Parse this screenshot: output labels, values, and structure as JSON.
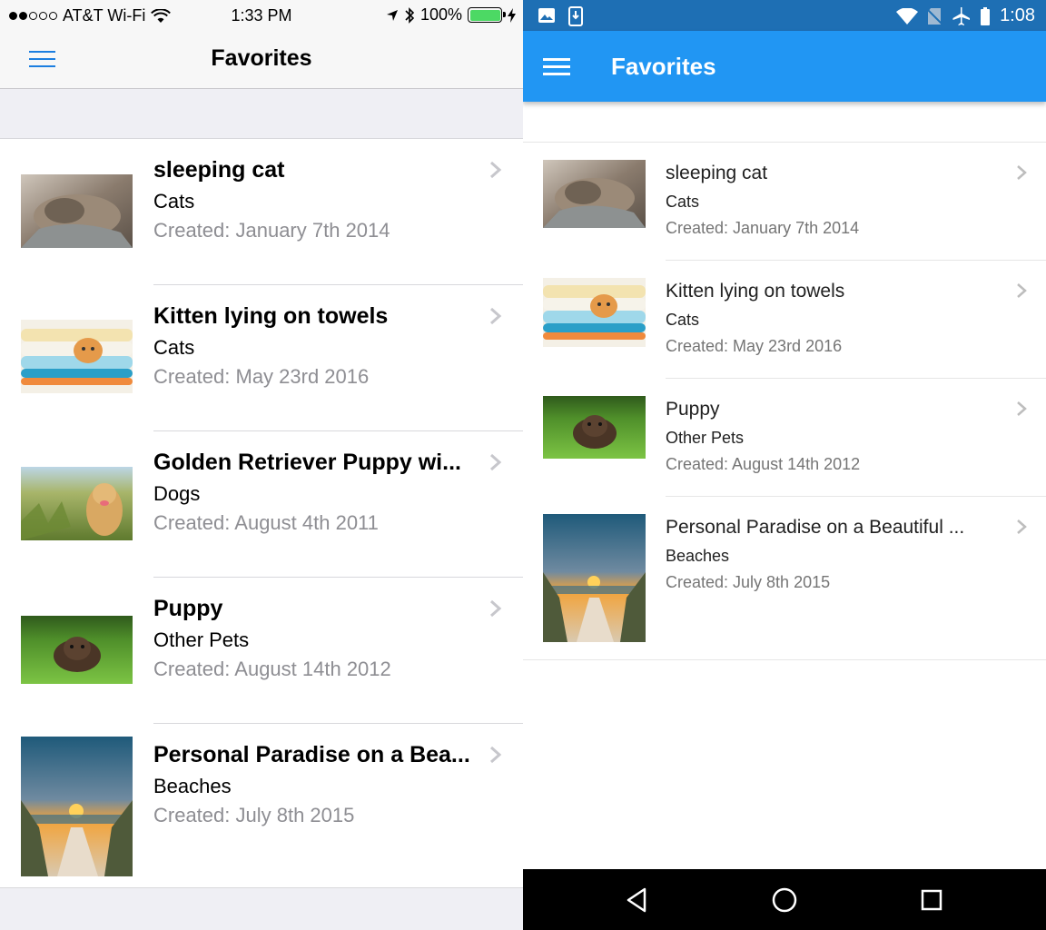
{
  "ios": {
    "status": {
      "carrier": "AT&T Wi-Fi",
      "time": "1:33 PM",
      "battery": "100%"
    },
    "nav": {
      "title": "Favorites"
    },
    "items": [
      {
        "title": "sleeping cat",
        "category": "Cats",
        "created": "Created: January 7th 2014",
        "thumb": "cat-photo"
      },
      {
        "title": "Kitten lying on towels",
        "category": "Cats",
        "created": "Created: May 23rd 2016",
        "thumb": "kitten-photo"
      },
      {
        "title": "Golden Retriever Puppy wi...",
        "category": "Dogs",
        "created": "Created: August 4th 2011",
        "thumb": "golden-puppy-photo"
      },
      {
        "title": "Puppy",
        "category": "Other Pets",
        "created": "Created: August 14th 2012",
        "thumb": "puppy-photo"
      },
      {
        "title": "Personal Paradise on a Bea...",
        "category": "Beaches",
        "created": "Created: July 8th 2015",
        "thumb": "beach-photo"
      }
    ]
  },
  "android": {
    "status": {
      "time": "1:08"
    },
    "appbar": {
      "title": "Favorites"
    },
    "items": [
      {
        "title": "sleeping cat",
        "category": "Cats",
        "created": "Created: January 7th 2014",
        "thumb": "cat-photo"
      },
      {
        "title": "Kitten lying on towels",
        "category": "Cats",
        "created": "Created: May 23rd 2016",
        "thumb": "kitten-photo"
      },
      {
        "title": "Puppy",
        "category": "Other Pets",
        "created": "Created: August 14th 2012",
        "thumb": "puppy-photo"
      },
      {
        "title": "Personal Paradise on a Beautiful ...",
        "category": "Beaches",
        "created": "Created: July 8th 2015",
        "thumb": "beach-photo"
      }
    ]
  },
  "colors": {
    "ios_tint": "#1c7ee0",
    "android_primary": "#2196f3",
    "android_status": "#1e6fb4"
  }
}
